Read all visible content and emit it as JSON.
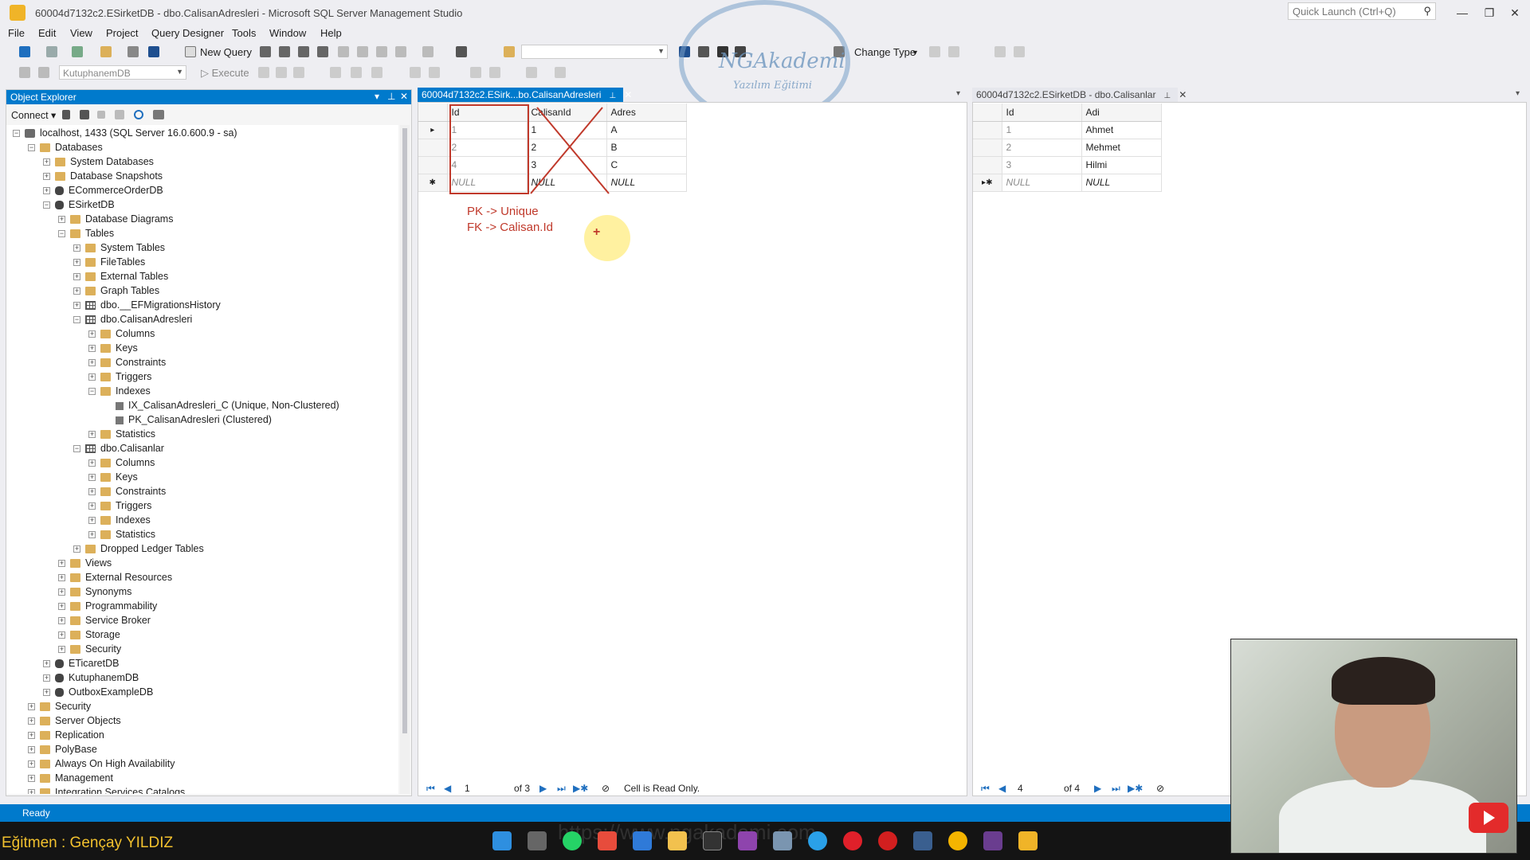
{
  "window": {
    "title": "60004d7132c2.ESirketDB - dbo.CalisanAdresleri - Microsoft SQL Server Management Studio",
    "quick_launch_placeholder": "Quick Launch (Ctrl+Q)"
  },
  "menu": [
    "File",
    "Edit",
    "View",
    "Project",
    "Query Designer",
    "Tools",
    "Window",
    "Help"
  ],
  "toolbar": {
    "new_query": "New Query",
    "change_type": "Change Type",
    "database": "KutuphanemDB",
    "execute": "Execute"
  },
  "logo": {
    "line1": "NGAkademi",
    "line2": "Yazılım Eğitimi"
  },
  "object_explorer": {
    "title": "Object Explorer",
    "connect": "Connect",
    "tree": [
      {
        "level": 0,
        "icon": "srv",
        "exp": "−",
        "label": "localhost, 1433 (SQL Server 16.0.600.9 - sa)"
      },
      {
        "level": 1,
        "icon": "folder",
        "exp": "−",
        "label": "Databases"
      },
      {
        "level": 2,
        "icon": "folder",
        "exp": "+",
        "label": "System Databases"
      },
      {
        "level": 2,
        "icon": "folder",
        "exp": "+",
        "label": "Database Snapshots"
      },
      {
        "level": 2,
        "icon": "db",
        "exp": "+",
        "label": "ECommerceOrderDB"
      },
      {
        "level": 2,
        "icon": "db",
        "exp": "−",
        "label": "ESirketDB"
      },
      {
        "level": 3,
        "icon": "folder",
        "exp": "+",
        "label": "Database Diagrams"
      },
      {
        "level": 3,
        "icon": "folder",
        "exp": "−",
        "label": "Tables"
      },
      {
        "level": 4,
        "icon": "folder",
        "exp": "+",
        "label": "System Tables"
      },
      {
        "level": 4,
        "icon": "folder",
        "exp": "+",
        "label": "FileTables"
      },
      {
        "level": 4,
        "icon": "folder",
        "exp": "+",
        "label": "External Tables"
      },
      {
        "level": 4,
        "icon": "folder",
        "exp": "+",
        "label": "Graph Tables"
      },
      {
        "level": 4,
        "icon": "tbl",
        "exp": "+",
        "label": "dbo.__EFMigrationsHistory"
      },
      {
        "level": 4,
        "icon": "tbl",
        "exp": "−",
        "label": "dbo.CalisanAdresleri"
      },
      {
        "level": 5,
        "icon": "folder",
        "exp": "+",
        "label": "Columns"
      },
      {
        "level": 5,
        "icon": "folder",
        "exp": "+",
        "label": "Keys"
      },
      {
        "level": 5,
        "icon": "folder",
        "exp": "+",
        "label": "Constraints"
      },
      {
        "level": 5,
        "icon": "folder",
        "exp": "+",
        "label": "Triggers"
      },
      {
        "level": 5,
        "icon": "folder",
        "exp": "−",
        "label": "Indexes"
      },
      {
        "level": 6,
        "icon": "idx",
        "exp": "",
        "label": "IX_CalisanAdresleri_C (Unique, Non-Clustered)"
      },
      {
        "level": 6,
        "icon": "idx",
        "exp": "",
        "label": "PK_CalisanAdresleri (Clustered)"
      },
      {
        "level": 5,
        "icon": "folder",
        "exp": "+",
        "label": "Statistics"
      },
      {
        "level": 4,
        "icon": "tbl",
        "exp": "−",
        "label": "dbo.Calisanlar"
      },
      {
        "level": 5,
        "icon": "folder",
        "exp": "+",
        "label": "Columns"
      },
      {
        "level": 5,
        "icon": "folder",
        "exp": "+",
        "label": "Keys"
      },
      {
        "level": 5,
        "icon": "folder",
        "exp": "+",
        "label": "Constraints"
      },
      {
        "level": 5,
        "icon": "folder",
        "exp": "+",
        "label": "Triggers"
      },
      {
        "level": 5,
        "icon": "folder",
        "exp": "+",
        "label": "Indexes"
      },
      {
        "level": 5,
        "icon": "folder",
        "exp": "+",
        "label": "Statistics"
      },
      {
        "level": 4,
        "icon": "folder",
        "exp": "+",
        "label": "Dropped Ledger Tables"
      },
      {
        "level": 3,
        "icon": "folder",
        "exp": "+",
        "label": "Views"
      },
      {
        "level": 3,
        "icon": "folder",
        "exp": "+",
        "label": "External Resources"
      },
      {
        "level": 3,
        "icon": "folder",
        "exp": "+",
        "label": "Synonyms"
      },
      {
        "level": 3,
        "icon": "folder",
        "exp": "+",
        "label": "Programmability"
      },
      {
        "level": 3,
        "icon": "folder",
        "exp": "+",
        "label": "Service Broker"
      },
      {
        "level": 3,
        "icon": "folder",
        "exp": "+",
        "label": "Storage"
      },
      {
        "level": 3,
        "icon": "folder",
        "exp": "+",
        "label": "Security"
      },
      {
        "level": 2,
        "icon": "db",
        "exp": "+",
        "label": "ETicaretDB"
      },
      {
        "level": 2,
        "icon": "db",
        "exp": "+",
        "label": "KutuphanemDB"
      },
      {
        "level": 2,
        "icon": "db",
        "exp": "+",
        "label": "OutboxExampleDB"
      },
      {
        "level": 1,
        "icon": "folder",
        "exp": "+",
        "label": "Security"
      },
      {
        "level": 1,
        "icon": "folder",
        "exp": "+",
        "label": "Server Objects"
      },
      {
        "level": 1,
        "icon": "folder",
        "exp": "+",
        "label": "Replication"
      },
      {
        "level": 1,
        "icon": "folder",
        "exp": "+",
        "label": "PolyBase"
      },
      {
        "level": 1,
        "icon": "folder",
        "exp": "+",
        "label": "Always On High Availability"
      },
      {
        "level": 1,
        "icon": "folder",
        "exp": "+",
        "label": "Management"
      },
      {
        "level": 1,
        "icon": "folder",
        "exp": "+",
        "label": "Integration Services Catalogs"
      }
    ]
  },
  "left_doc": {
    "tab": "60004d7132c2.ESirk...bo.CalisanAdresleri",
    "columns": [
      "Id",
      "CalisanId",
      "Adres"
    ],
    "rows": [
      {
        "marker": "▸",
        "cells": [
          "1",
          "1",
          "A"
        ]
      },
      {
        "marker": "",
        "cells": [
          "2",
          "2",
          "B"
        ]
      },
      {
        "marker": "",
        "cells": [
          "4",
          "3",
          "C"
        ]
      },
      {
        "marker": "✱",
        "cells": [
          "NULL",
          "NULL",
          "NULL"
        ]
      }
    ],
    "pager": {
      "current": "1",
      "of": "of 3",
      "status": "Cell is Read Only."
    },
    "notes": [
      "PK -> Unique",
      "FK -> Calisan.Id"
    ]
  },
  "right_doc": {
    "tab": "60004d7132c2.ESirketDB - dbo.Calisanlar",
    "columns": [
      "Id",
      "Adi"
    ],
    "rows": [
      {
        "marker": "",
        "cells": [
          "1",
          "Ahmet"
        ]
      },
      {
        "marker": "",
        "cells": [
          "2",
          "Mehmet"
        ]
      },
      {
        "marker": "",
        "cells": [
          "3",
          "Hilmi"
        ]
      },
      {
        "marker": "▸✱",
        "cells": [
          "NULL",
          "NULL"
        ]
      }
    ],
    "pager": {
      "current": "4",
      "of": "of 4"
    }
  },
  "status": "Ready",
  "trainer": "Eğitmen : Gençay YILDIZ",
  "watermark": "https://www.ngakademi.com"
}
